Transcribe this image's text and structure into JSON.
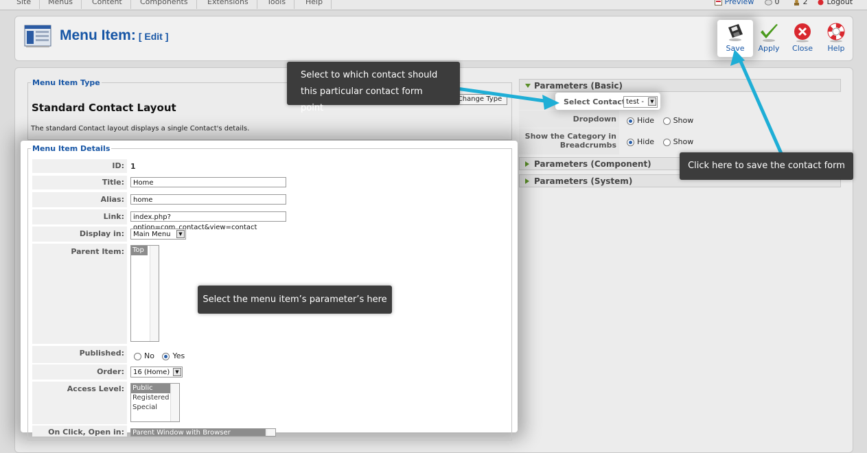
{
  "top_menu": {
    "items": [
      "Site",
      "Menus",
      "Content",
      "Components",
      "Extensions",
      "Tools",
      "Help"
    ],
    "preview_label": "Preview",
    "messages_count": "0",
    "users_count": "2",
    "logout_label": "Logout"
  },
  "header": {
    "title": "Menu Item:",
    "subtitle": "[ Edit ]"
  },
  "toolbar": {
    "save_label": "Save",
    "apply_label": "Apply",
    "close_label": "Close",
    "help_label": "Help"
  },
  "menu_item_type": {
    "legend": "Menu Item Type",
    "title": "Standard Contact Layout",
    "description": "The standard Contact layout displays a single Contact's details.",
    "change_type_label": "Change Type"
  },
  "details": {
    "legend": "Menu Item Details",
    "id_label": "ID:",
    "id_value": "1",
    "title_label": "Title:",
    "title_value": "Home",
    "alias_label": "Alias:",
    "alias_value": "home",
    "link_label": "Link:",
    "link_value": "index.php?option=com_contact&view=contact",
    "display_in_label": "Display in:",
    "display_in_value": "Main Menu",
    "parent_label": "Parent Item:",
    "parent_option": "Top",
    "published_label": "Published:",
    "published_no": "No",
    "published_yes": "Yes",
    "order_label": "Order:",
    "order_value": "16 (Home)",
    "access_label": "Access Level:",
    "access_options": [
      "Public",
      "Registered",
      "Special"
    ],
    "onclick_label": "On Click, Open in:",
    "onclick_option": "Parent Window with Browser Navigation"
  },
  "params": {
    "basic_header": "Parameters (Basic)",
    "select_contact_label": "Select Contact",
    "select_contact_value": "test -",
    "dropdown_label": "Dropdown",
    "show_category_label": "Show the Category in Breadcrumbs",
    "hide_label": "Hide",
    "show_label": "Show",
    "component_header": "Parameters (Component)",
    "system_header": "Parameters (System)"
  },
  "callouts": {
    "contact_callout": "Select to which contact should this particular contact form point",
    "save_callout": "Click here to save the contact form",
    "params_callout": "Select the menu item’s parameter’s here"
  },
  "colors": {
    "accent_blue": "#1655a5",
    "callout_bg": "#3c3c3c",
    "arrow_cyan": "#1eaed6",
    "apply_green": "#4a9a1c",
    "close_red": "#d9282f"
  }
}
